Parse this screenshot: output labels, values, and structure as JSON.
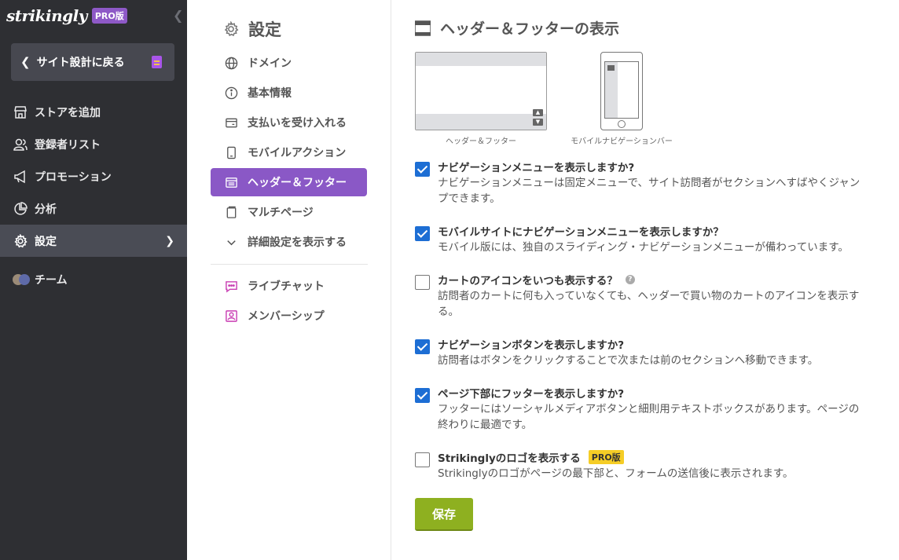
{
  "sidebar": {
    "logo": "strikingly",
    "pro_badge": "PRO版",
    "back_button": "サイト設計に戻る",
    "items": [
      {
        "label": "ストアを追加",
        "icon": "store-icon"
      },
      {
        "label": "登録者リスト",
        "icon": "users-icon"
      },
      {
        "label": "プロモーション",
        "icon": "megaphone-icon"
      },
      {
        "label": "分析",
        "icon": "pie-chart-icon"
      },
      {
        "label": "設定",
        "icon": "gear-icon",
        "active": true
      },
      {
        "label": "チーム",
        "icon": "team-avatar-icon"
      }
    ]
  },
  "settings_nav": {
    "title": "設定",
    "items": [
      {
        "label": "ドメイン",
        "icon": "globe-icon"
      },
      {
        "label": "基本情報",
        "icon": "info-icon"
      },
      {
        "label": "支払いを受け入れる",
        "icon": "credit-card-icon"
      },
      {
        "label": "モバイルアクション",
        "icon": "mobile-icon"
      },
      {
        "label": "ヘッダー＆フッター",
        "icon": "header-footer-icon",
        "active": true
      },
      {
        "label": "マルチページ",
        "icon": "pages-icon"
      },
      {
        "label": "詳細設定を表示する",
        "icon": "chevron-down-icon"
      }
    ],
    "apps": [
      {
        "label": "ライブチャット",
        "icon": "chat-icon"
      },
      {
        "label": "メンバーシップ",
        "icon": "member-icon"
      }
    ]
  },
  "main": {
    "title": "ヘッダー＆フッターの表示",
    "preview_desktop_caption": "ヘッダー＆フッター",
    "preview_mobile_caption": "モバイルナビゲーションバー",
    "options": [
      {
        "checked": true,
        "title": "ナビゲーションメニューを表示しますか?",
        "desc": "ナビゲーションメニューは固定メニューで、サイト訪問者がセクションへすばやくジャンプできます。"
      },
      {
        "checked": true,
        "title": "モバイルサイトにナビゲーションメニューを表示しますか？",
        "desc": "モバイル版には、独自のスライディング・ナビゲーションメニューが備わっています。"
      },
      {
        "checked": false,
        "title": "カートのアイコンをいつも表示する？",
        "desc": "訪問者のカートに何も入っていなくても、ヘッダーで買い物のカートのアイコンを表示する。",
        "help": "?"
      },
      {
        "checked": true,
        "title": "ナビゲーションボタンを表示しますか?",
        "desc": "訪問者はボタンをクリックすることで次または前のセクションへ移動できます。"
      },
      {
        "checked": true,
        "title": "ページ下部にフッターを表示しますか?",
        "desc": "フッターにはソーシャルメディアボタンと細則用テキストボックスがあります。ページの終わりに最適です。"
      },
      {
        "checked": false,
        "title": "Strikinglyのロゴを表示する",
        "desc": "Strikinglyのロゴがページの最下部と、フォームの送信後に表示されます。",
        "pro_tag": "PRO版"
      }
    ],
    "save_label": "保存"
  },
  "colors": {
    "sidebar_bg": "#2e2f33",
    "accent_purple": "#8a58c6",
    "checkbox_blue": "#1d6ed4",
    "save_green": "#8eb020",
    "pro_yellow": "#f5cd26"
  }
}
